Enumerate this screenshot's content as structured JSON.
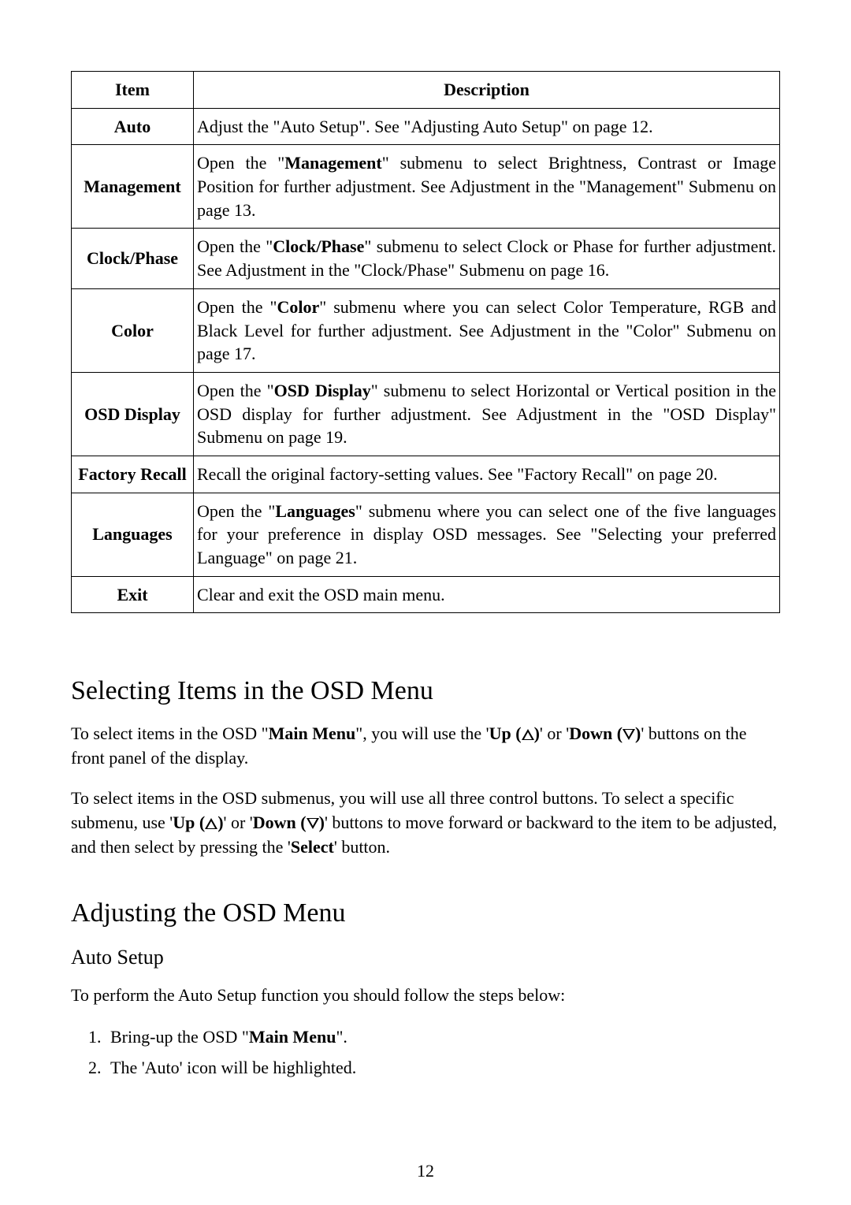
{
  "table": {
    "headers": {
      "item": "Item",
      "description": "Description"
    },
    "rows": [
      {
        "item": "Auto",
        "desc_pre": "Adjust the \"Auto Setup\". See \"Adjusting Auto Setup\" on page 12."
      },
      {
        "item": "Management",
        "desc_pre": "Open the \"",
        "desc_bold": "Management",
        "desc_post": "\" submenu to select Brightness, Contrast or Image Position for further adjustment. See Adjustment in the \"Management\" Submenu on page 13."
      },
      {
        "item": "Clock/Phase",
        "desc_pre": "Open the \"",
        "desc_bold": "Clock/Phase",
        "desc_post": "\" submenu to select Clock or Phase for further adjustment. See Adjustment in the \"Clock/Phase\" Submenu on page 16."
      },
      {
        "item": "Color",
        "desc_pre": "Open the \"",
        "desc_bold": "Color",
        "desc_post": "\" submenu where you can select Color Temperature, RGB and Black Level for further adjustment. See Adjustment in the \"Color\" Submenu on page 17."
      },
      {
        "item": "OSD Display",
        "desc_pre": "Open the \"",
        "desc_bold": "OSD Display",
        "desc_post": "\" submenu to select Horizontal or Vertical position in the OSD display for further adjustment. See Adjustment in the \"OSD Display\" Submenu on page 19."
      },
      {
        "item": "Factory Recall",
        "desc_pre": "Recall the original factory-setting values. See \"Factory Recall\" on page 20."
      },
      {
        "item": "Languages",
        "desc_pre": "Open the \"",
        "desc_bold": "Languages",
        "desc_post": "\" submenu where you can select one of the five languages for your preference in display OSD messages. See \"Selecting your preferred Language\" on page 21."
      },
      {
        "item": "Exit",
        "desc_pre": "Clear and exit the OSD main menu."
      }
    ]
  },
  "selecting": {
    "heading": "Selecting Items in the OSD Menu",
    "p1_a": "To select items in the OSD \"",
    "p1_b": "Main Menu",
    "p1_c": "\", you will use the '",
    "p1_d": "Up (",
    "p1_e": ")",
    "p1_f": "' or '",
    "p1_g": "Down (",
    "p1_h": ")",
    "p1_i": "' buttons on the front panel of the display.",
    "p2_a": "To select items in the OSD submenus, you will use all three control buttons. To select a specific submenu, use '",
    "p2_b": "Up (",
    "p2_c": ")",
    "p2_d": "' or '",
    "p2_e": "Down (",
    "p2_f": ")",
    "p2_g": "' buttons to move forward or backward to the item to be adjusted, and then select by pressing the '",
    "p2_h": "Select",
    "p2_i": "' button."
  },
  "adjusting": {
    "heading": "Adjusting the OSD Menu",
    "sub": "Auto Setup",
    "p1": "To perform the Auto Setup function you should follow the steps below:",
    "steps": {
      "s1_a": "Bring-up the OSD \"",
      "s1_b": "Main Menu",
      "s1_c": "\".",
      "s2": "The 'Auto' icon will be highlighted."
    }
  },
  "page_number": "12"
}
